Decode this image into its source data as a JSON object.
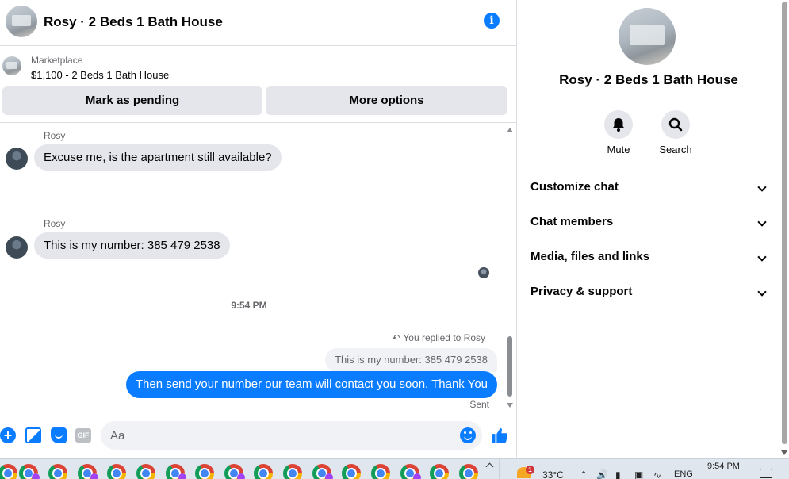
{
  "header": {
    "title": "Rosy · 2 Beds 1 Bath House"
  },
  "marketplace": {
    "label": "Marketplace",
    "item": "$1,100 - 2 Beds 1 Bath House",
    "pending_label": "Mark as pending",
    "more_label": "More options"
  },
  "messages": {
    "sender": "Rosy",
    "msg1": "Excuse me, is the apartment still available?",
    "msg2": "This is my number: 385 479 2538",
    "time": "9:54 PM",
    "replied": "You replied to Rosy",
    "quoted": "This is my number: 385 479 2538",
    "reply": "Then send your number our team will contact you soon. Thank You",
    "status": "Sent"
  },
  "composer": {
    "placeholder": "Aa",
    "gif_label": "GIF"
  },
  "panel": {
    "name": "Rosy · 2 Beds 1 Bath House",
    "mute_label": "Mute",
    "search_label": "Search",
    "sections": [
      "Customize chat",
      "Chat members",
      "Media, files and links",
      "Privacy & support"
    ]
  },
  "taskbar": {
    "weather_badge": "1",
    "temperature": "33°C",
    "language": "ENG",
    "time": "9:54 PM"
  },
  "colors": {
    "accent": "#0a7cff",
    "bubble_in": "#e4e6eb",
    "secondary_text": "#65676b"
  }
}
